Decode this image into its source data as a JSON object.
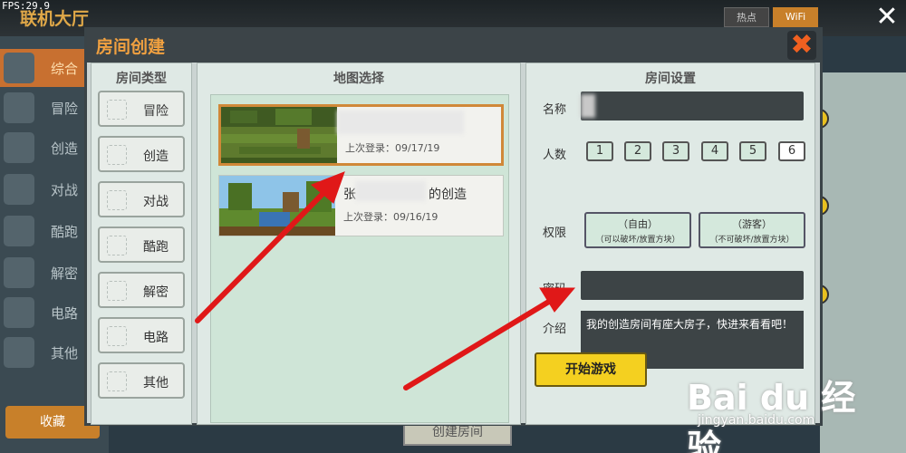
{
  "status": {
    "fps": "FPS:29.9"
  },
  "lobby": {
    "title": "联机大厅",
    "tabs": [
      {
        "label": "热点"
      },
      {
        "label": "WiFi"
      }
    ],
    "categories": [
      {
        "label": "综合"
      },
      {
        "label": "冒险"
      },
      {
        "label": "创造"
      },
      {
        "label": "对战"
      },
      {
        "label": "酷跑"
      },
      {
        "label": "解密"
      },
      {
        "label": "电路"
      },
      {
        "label": "其他"
      }
    ],
    "favorite_label": "收藏",
    "create_room_label": "创建房间"
  },
  "dialog": {
    "title": "房间创建",
    "room_types": {
      "title": "房间类型",
      "items": [
        {
          "label": "冒险",
          "icon": "sword-icon"
        },
        {
          "label": "创造",
          "icon": "block-icon"
        },
        {
          "label": "对战",
          "icon": "fight-icon"
        },
        {
          "label": "酷跑",
          "icon": "run-icon"
        },
        {
          "label": "解密",
          "icon": "puzzle-icon"
        },
        {
          "label": "电路",
          "icon": "circuit-icon"
        },
        {
          "label": "其他",
          "icon": "more-icon"
        }
      ]
    },
    "map_select": {
      "title": "地图选择",
      "maps": [
        {
          "name": "",
          "last_login": "上次登录：09/17/19",
          "selected": true
        },
        {
          "name": "张",
          "name_suffix": "的创造",
          "last_login": "上次登录：09/16/19",
          "selected": false
        }
      ]
    },
    "settings": {
      "title": "房间设置",
      "name_label": "名称",
      "name_value": "",
      "players_label": "人数",
      "player_options": [
        "1",
        "2",
        "3",
        "4",
        "5",
        "6"
      ],
      "players_selected": "6",
      "permission_label": "权限",
      "permissions": [
        {
          "main": "（自由）",
          "sub": "（可以破坏/放置方块）"
        },
        {
          "main": "（游客）",
          "sub": "（不可破坏/放置方块）"
        }
      ],
      "password_label": "密码",
      "password_value": "",
      "intro_label": "介绍",
      "intro_value": "我的创造房间有座大房子，快进来看看吧！"
    },
    "start_label": "开始游戏"
  },
  "watermark": {
    "logo": "Bai du 经验",
    "url": "jingyan.baidu.com"
  },
  "colors": {
    "accent": "#f0a040",
    "dialog_bg": "#cbd4d2",
    "start_button": "#f4d020",
    "arrow": "#e01818"
  }
}
